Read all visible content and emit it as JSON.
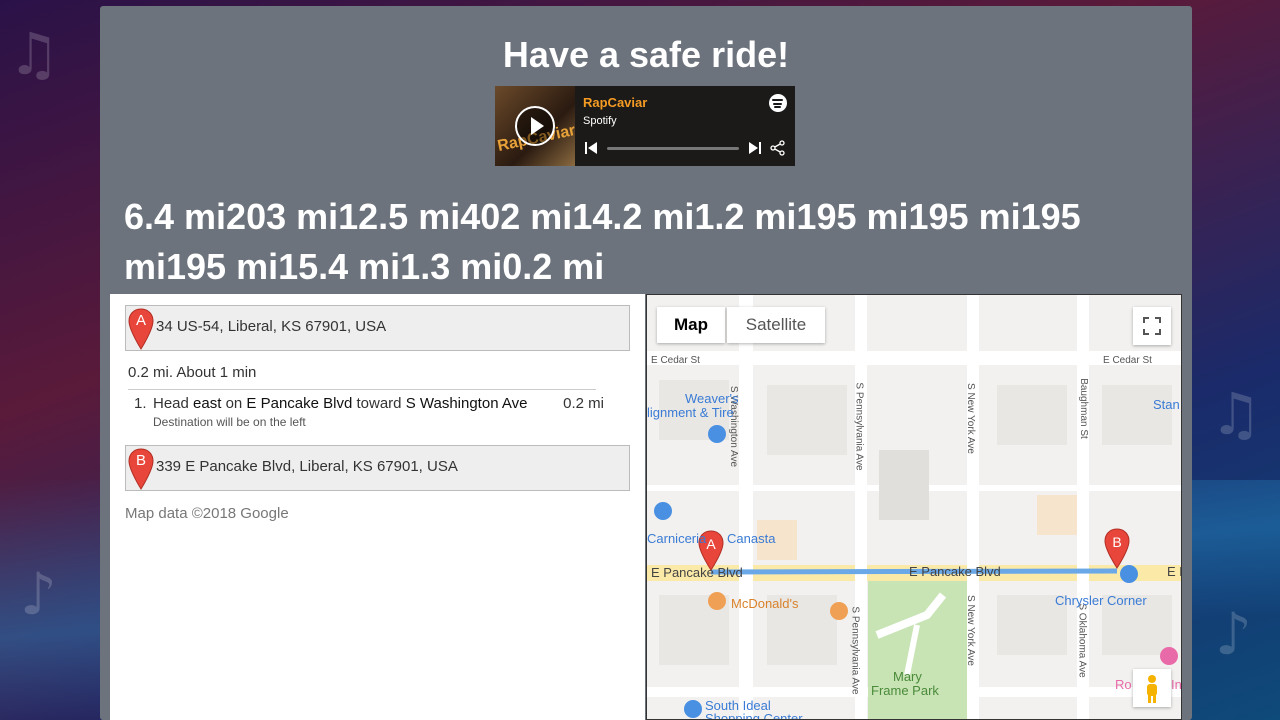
{
  "page": {
    "title": "Have a safe ride!",
    "distances_text": "6.4 mi203 mi12.5 mi402 mi14.2 mi1.2 mi195 mi195 mi195 mi195 mi15.4 mi1.3 mi0.2 mi"
  },
  "player": {
    "playlist_name": "RapCaviar",
    "source": "Spotify",
    "cover_text": "RapCaviar",
    "icons": [
      "play-icon",
      "spotify-logo-icon",
      "previous-track-icon",
      "next-track-icon",
      "share-icon"
    ]
  },
  "directions": {
    "start": {
      "marker": "A",
      "address": "34 US-54, Liberal, KS 67901, USA"
    },
    "summary": "0.2 mi. About 1 min",
    "steps": [
      {
        "number": "1.",
        "instruction": {
          "verb": "Head",
          "direction": "east",
          "on_word": "on",
          "street": "E Pancake Blvd",
          "toward_word": "toward",
          "toward_street": "S Washington Ave"
        },
        "distance": "0.2 mi",
        "note": "Destination will be on the left"
      }
    ],
    "end": {
      "marker": "B",
      "address": "339 E Pancake Blvd, Liberal, KS 67901, USA"
    },
    "copyright": "Map data ©2018 Google"
  },
  "map": {
    "type_buttons": [
      "Map",
      "Satellite"
    ],
    "selected_type": "Map",
    "streets": {
      "cedar_left": "E Cedar St",
      "cedar_right": "E Cedar St",
      "washington": "S Washington Ave",
      "pennsylvania_top": "S Pennsylvania Ave",
      "new_york_top": "S New York Ave",
      "baughman": "Baughman St",
      "pancake_left": "E Pancake Blvd",
      "pancake_mid": "E Pancake Blvd",
      "pancake_right": "E P",
      "pennsylvania_bottom": "S Pennsylvania Ave",
      "new_york_bottom": "S New York Ave",
      "oklahoma": "S Oklahoma Ave"
    },
    "places": {
      "weavers_1": "Weaver's",
      "weavers_2": "lignment & Tire",
      "stan": "Stan",
      "carniceria": "Carniceria",
      "canasta": "Canasta",
      "mcdonalds": "McDonald's",
      "chrysler": "Chrysler Corner",
      "mary_1": "Mary",
      "mary_2": "Frame Park",
      "south_ideal_1": "South Ideal",
      "south_ideal_2": "Shopping Center",
      "ro": "Ro",
      "in": "In"
    },
    "markers": [
      "A",
      "B"
    ],
    "colors": {
      "route": "#6aa8e8",
      "marker": "#e8463a",
      "park": "#c8e4b4",
      "road": "#fbe9a8"
    }
  }
}
